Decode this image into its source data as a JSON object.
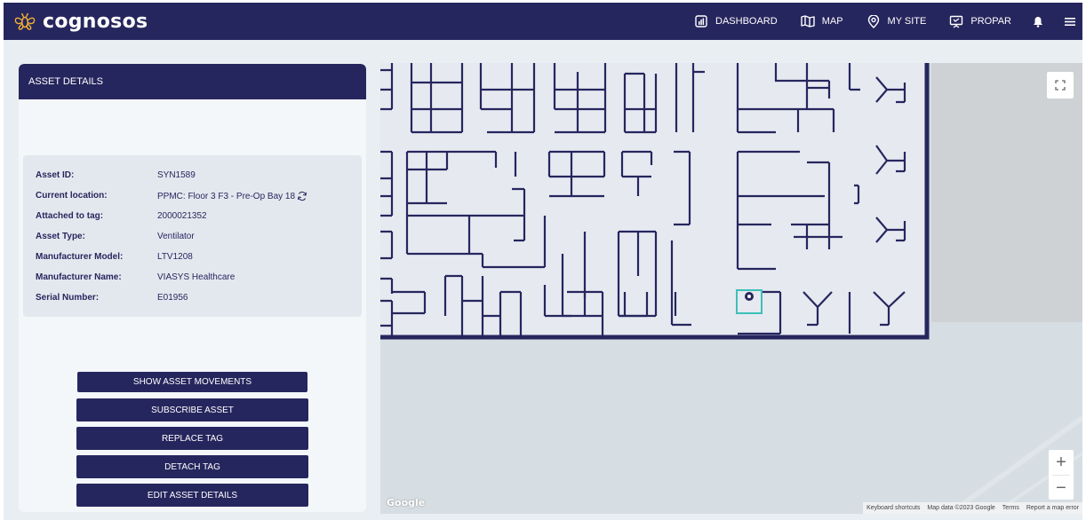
{
  "brand": {
    "name": "cognosos",
    "logo_icon": "bee-logo-icon"
  },
  "nav": {
    "dashboard": "DASHBOARD",
    "map": "MAP",
    "my_site": "MY SITE",
    "propar": "PROPAR"
  },
  "panel": {
    "title": "ASSET DETAILS",
    "fields": [
      {
        "label": "Asset ID:",
        "value": "SYN1589"
      },
      {
        "label": "Current location:",
        "value": "PPMC: Floor 3 F3 - Pre-Op Bay 18"
      },
      {
        "label": "Attached to tag:",
        "value": "2000021352"
      },
      {
        "label": "Asset Type:",
        "value": "Ventilator"
      },
      {
        "label": "Manufacturer Model:",
        "value": "LTV1208"
      },
      {
        "label": "Manufacturer Name:",
        "value": "VIASYS Healthcare"
      },
      {
        "label": "Serial Number:",
        "value": "E01956"
      }
    ],
    "buttons": {
      "show_movements": "SHOW ASSET MOVEMENTS",
      "subscribe": "SUBSCRIBE ASSET",
      "replace_tag": "REPLACE TAG",
      "detach_tag": "DETACH TAG",
      "edit_details": "EDIT ASSET DETAILS"
    }
  },
  "map": {
    "google_logo": "Google",
    "zoom_in": "+",
    "zoom_out": "−",
    "attribution": {
      "shortcuts": "Keyboard shortcuts",
      "data": "Map data ©2023 Google",
      "terms": "Terms",
      "report": "Report a map error"
    }
  },
  "colors": {
    "brand_navy": "#26265e",
    "highlight_teal": "#3cc0b8",
    "map_bg": "#d6dee3",
    "floor_bg": "#e6e9f0"
  }
}
